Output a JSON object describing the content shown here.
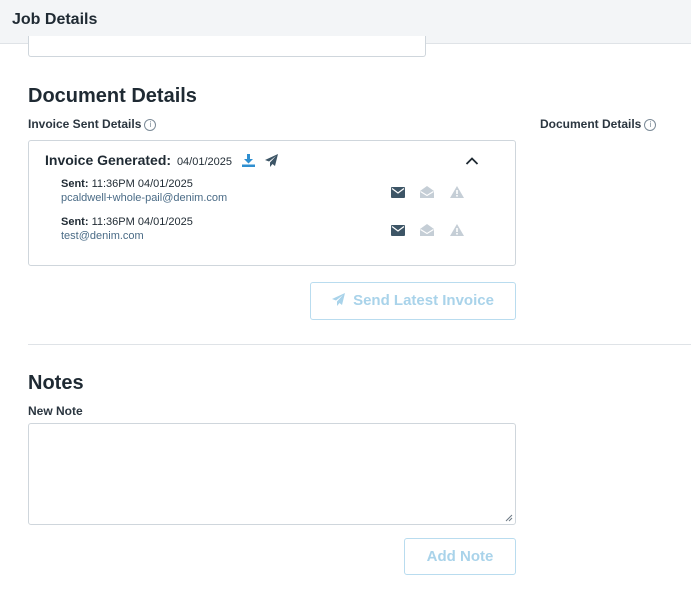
{
  "header": {
    "title": "Job Details"
  },
  "document_section": {
    "heading": "Document Details",
    "invoice_sent_label": "Invoice Sent Details",
    "document_details_label": "Document Details",
    "invoice_card": {
      "generated_label": "Invoice Generated:",
      "generated_date": "04/01/2025",
      "rows": [
        {
          "sent_label": "Sent:",
          "sent_time": "11:36PM 04/01/2025",
          "email": "pcaldwell+whole-pail@denim.com"
        },
        {
          "sent_label": "Sent:",
          "sent_time": "11:36PM 04/01/2025",
          "email": "test@denim.com"
        }
      ]
    },
    "send_button_label": "Send Latest Invoice"
  },
  "notes_section": {
    "heading": "Notes",
    "new_note_label": "New Note",
    "textarea_value": "",
    "add_button_label": "Add Note"
  },
  "colors": {
    "accent": "#2f8fd0",
    "icon_dark": "#3d5566",
    "icon_light": "#c5ced6",
    "disabled_button_text": "#a9d3ea"
  }
}
